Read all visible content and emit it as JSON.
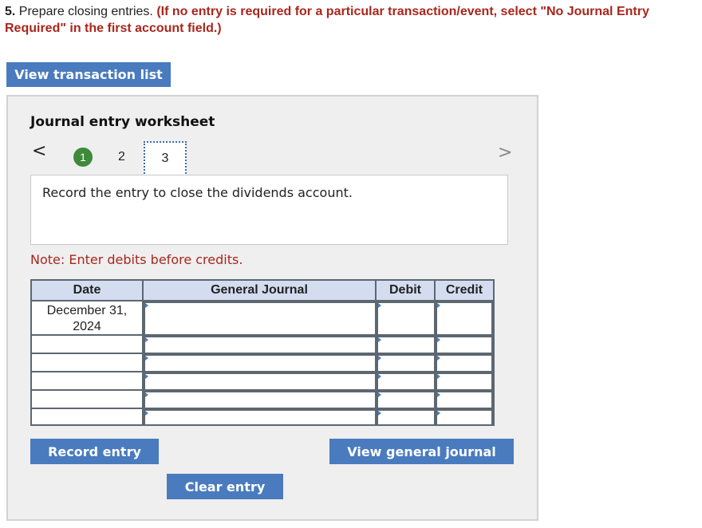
{
  "instructions": {
    "number": "5.",
    "text": " Prepare closing entries. ",
    "bold_red": "(If no entry is required for a particular transaction/event, select \"No Journal Entry Required\" in the first account field.)"
  },
  "buttons": {
    "view_transaction_list": "View transaction list",
    "record_entry": "Record entry",
    "view_general_journal": "View general journal",
    "clear_entry": "Clear entry"
  },
  "worksheet": {
    "title": "Journal entry worksheet",
    "nav_prev": "<",
    "nav_next": ">",
    "steps": [
      "1",
      "2",
      "3"
    ],
    "current_step": "3",
    "prompt": "Record the entry to close the dividends account.",
    "note": "Note: Enter debits before credits."
  },
  "journal": {
    "headers": [
      "Date",
      "General Journal",
      "Debit",
      "Credit"
    ],
    "date_line1": "December 31,",
    "date_line2": "2024"
  },
  "colors": {
    "button_blue": "#4a7bbf",
    "accent_red": "#a8261d",
    "step_complete_green": "#3e8a3a",
    "header_blue": "#d4ddf0"
  }
}
